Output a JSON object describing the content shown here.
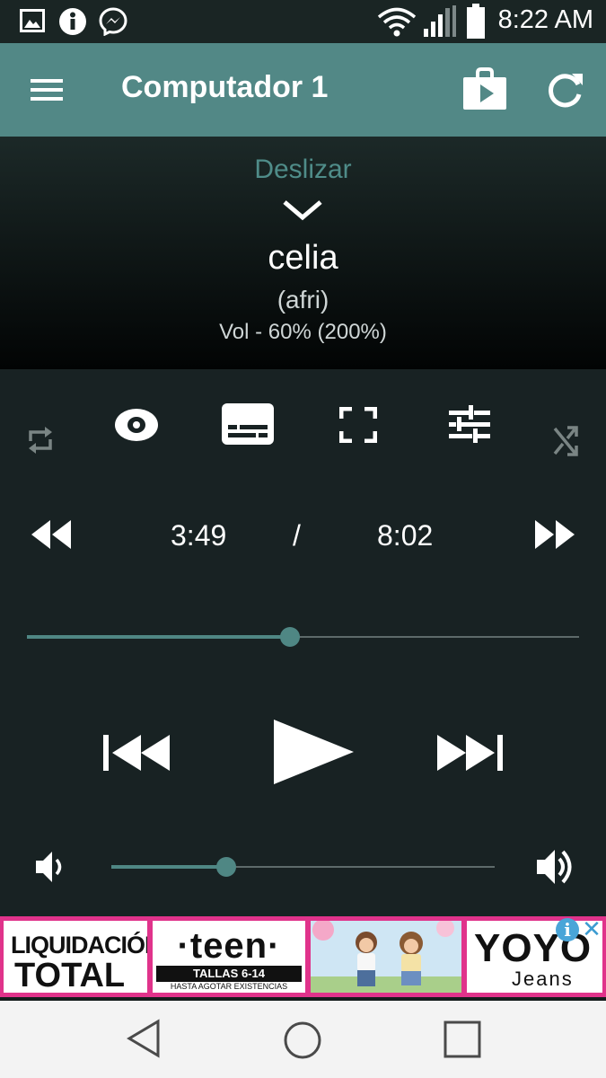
{
  "status_bar": {
    "time": "8:22 AM",
    "icons": [
      "image-icon",
      "info-icon",
      "messenger-icon",
      "wifi-icon",
      "signal-icon",
      "battery-icon"
    ]
  },
  "toolbar": {
    "title": "Computador 1",
    "icons": [
      "menu-icon",
      "play-store-icon",
      "refresh-icon"
    ]
  },
  "now_playing": {
    "swipe_label": "Deslizar",
    "title": "celia",
    "artist": "(afri)",
    "volume_text": "Vol - 60% (200%)"
  },
  "playback": {
    "current_time": "3:49",
    "separator": "/",
    "total_time": "8:02",
    "progress_fraction": 0.476,
    "volume_fraction": 0.3
  },
  "ad": {
    "tile1_line1": "LIQUIDACIÓN",
    "tile1_line2": "TOTAL",
    "tile2_brand": "·teen·",
    "tile2_bar": "TALLAS 6-14",
    "tile2_sub": "HASTA AGOTAR EXISTENCIAS",
    "tile4_brand": "YOYO",
    "tile4_sub": "Jeans",
    "info_glyph": "i",
    "close_glyph": "✕"
  },
  "colors": {
    "accent": "#528886",
    "accent_dark": "#4f8784",
    "background": "#182223",
    "ad_border": "#e0338b"
  }
}
